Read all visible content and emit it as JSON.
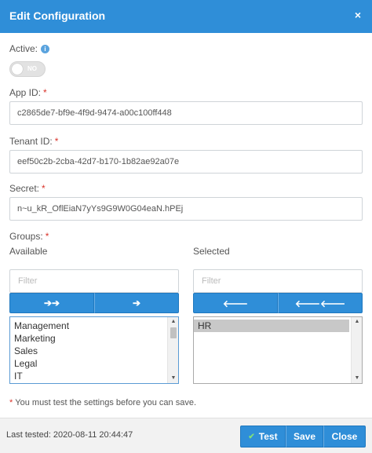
{
  "header": {
    "title": "Edit Configuration",
    "close_glyph": "×"
  },
  "active": {
    "label": "Active:",
    "info_glyph": "i",
    "toggle_text": "NO",
    "value": false
  },
  "app_id": {
    "label": "App ID:",
    "required": "*",
    "value": "c2865de7-bf9e-4f9d-9474-a00c100ff448"
  },
  "tenant_id": {
    "label": "Tenant ID:",
    "required": "*",
    "value": "eef50c2b-2cba-42d7-b170-1b82ae92a07e"
  },
  "secret": {
    "label": "Secret:",
    "required": "*",
    "value": "n~u_kR_OflEiaN7yYs9G9W0G04eaN.hPEj"
  },
  "groups": {
    "label": "Groups:",
    "required": "*",
    "available": {
      "label": "Available",
      "filter_placeholder": "Filter",
      "move_all_glyph": "➔➔",
      "move_selected_glyph": "➔",
      "items": [
        "Management",
        "Marketing",
        "Sales",
        "Legal",
        "IT"
      ]
    },
    "selected": {
      "label": "Selected",
      "filter_placeholder": "Filter",
      "remove_selected_glyph": "🡐",
      "remove_all_glyph": "🡐🡐",
      "items": [
        "HR"
      ]
    }
  },
  "note": {
    "asterisk": "*",
    "text": "You must test the settings before you can save."
  },
  "footer": {
    "last_tested": "Last tested: 2020-08-11 20:44:47",
    "test_label": "Test",
    "test_check": "✔",
    "save_label": "Save",
    "close_label": "Close"
  },
  "colors": {
    "primary": "#2f8ed8",
    "required": "#d9342b",
    "check": "#7fe07a"
  }
}
